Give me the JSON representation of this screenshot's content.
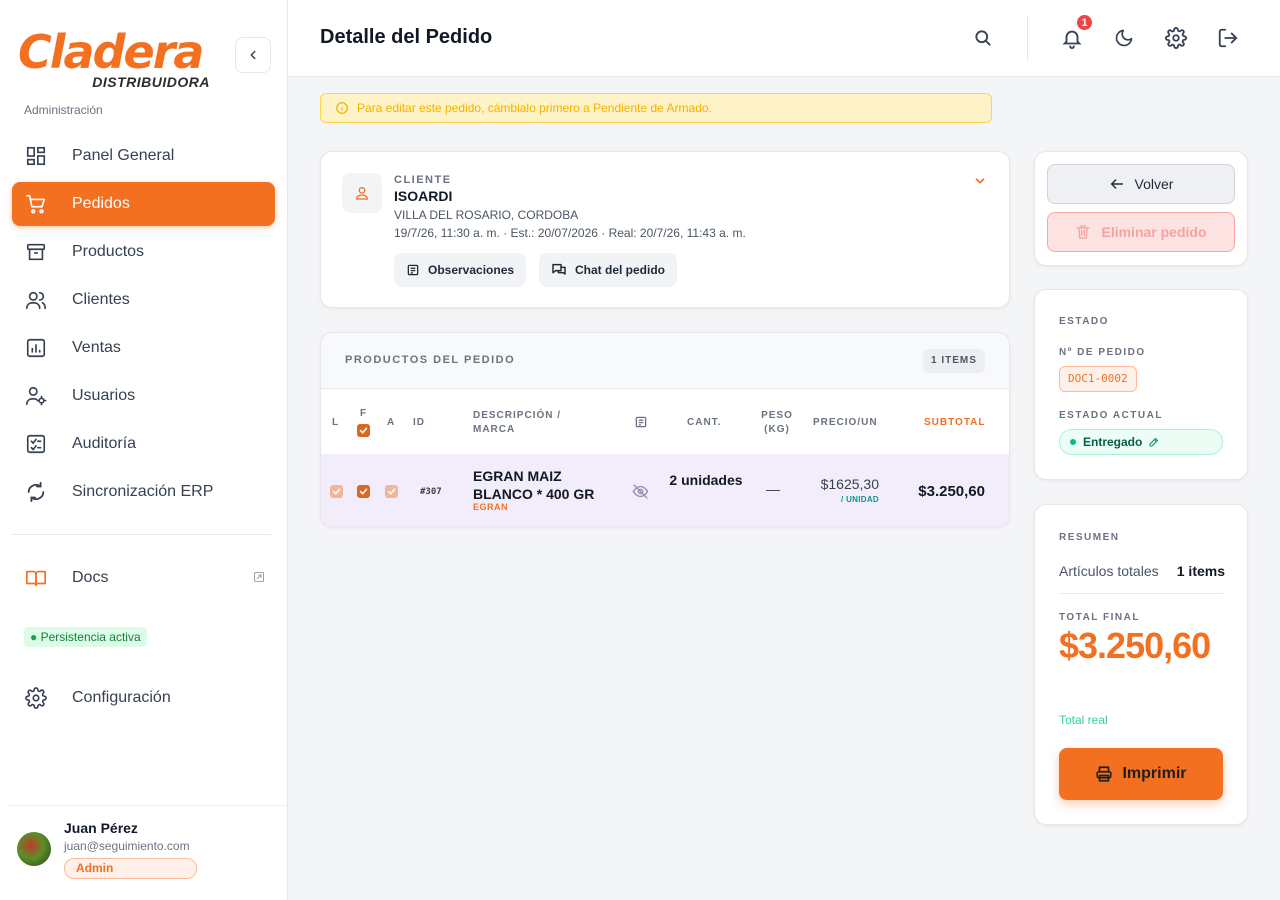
{
  "brand": {
    "name": "Cladera",
    "subtitle": "DISTRIBUIDORA",
    "accent": "#f37021"
  },
  "sidebar": {
    "section_label": "Administración",
    "items": [
      {
        "label": "Panel General",
        "icon": "dashboard-icon",
        "active": false
      },
      {
        "label": "Pedidos",
        "icon": "cart-icon",
        "active": true
      },
      {
        "label": "Productos",
        "icon": "archive-icon",
        "active": false
      },
      {
        "label": "Clientes",
        "icon": "users-icon",
        "active": false
      },
      {
        "label": "Ventas",
        "icon": "chart-icon",
        "active": false
      },
      {
        "label": "Usuarios",
        "icon": "user-cog-icon",
        "active": false
      },
      {
        "label": "Auditoría",
        "icon": "checklist-icon",
        "active": false
      },
      {
        "label": "Sincronización ERP",
        "icon": "sync-icon",
        "active": false
      }
    ],
    "docs_label": "Docs",
    "persistence_label": "Persistencia activa",
    "config_label": "Configuración"
  },
  "user": {
    "name": "Juan Pérez",
    "email": "juan@seguimiento.com",
    "role": "Admin"
  },
  "header": {
    "title": "Detalle del Pedido",
    "notification_count": "1"
  },
  "warning": "Para editar este pedido, cámbialo primero a Pendiente de Armado.",
  "client": {
    "label": "CLIENTE",
    "name": "ISOARDI",
    "location": "VILLA DEL ROSARIO, CORDOBA",
    "dates": "19/7/26, 11:30 a. m. · Est.: 20/07/2026 · Real: 20/7/26, 11:43 a. m.",
    "observations_label": "Observaciones",
    "chat_label": "Chat del pedido"
  },
  "products": {
    "title": "PRODUCTOS DEL PEDIDO",
    "count": "1 ITEMS",
    "columns": {
      "l": "L",
      "f": "F",
      "a": "A",
      "id": "ID",
      "desc": "DESCRIPCIÓN / MARCA",
      "qty": "CANT.",
      "weight": "PESO (KG)",
      "price": "PRECIO/UN",
      "subtotal": "SUBTOTAL"
    },
    "rows": [
      {
        "id": "#307",
        "description": "EGRAN MAIZ BLANCO * 400 GR",
        "brand": "EGRAN",
        "qty": "2 unidades",
        "weight": "—",
        "price": "$1625,30",
        "price_unit": "/ UNIDAD",
        "subtotal": "$3.250,60",
        "l": true,
        "f": true,
        "a": true
      }
    ]
  },
  "actions": {
    "back_label": "Volver",
    "delete_label": "Eliminar pedido"
  },
  "state": {
    "title": "ESTADO",
    "order_no_label": "Nº DE PEDIDO",
    "order_no": "DOC1-0002",
    "current_label": "ESTADO ACTUAL",
    "current": "Entregado"
  },
  "summary": {
    "title": "RESUMEN",
    "items_label": "Artículos totales",
    "items_value": "1 items",
    "total_label": "TOTAL FINAL",
    "total": "$3.250,60",
    "total_note": "Total real",
    "print_label": "Imprimir"
  }
}
